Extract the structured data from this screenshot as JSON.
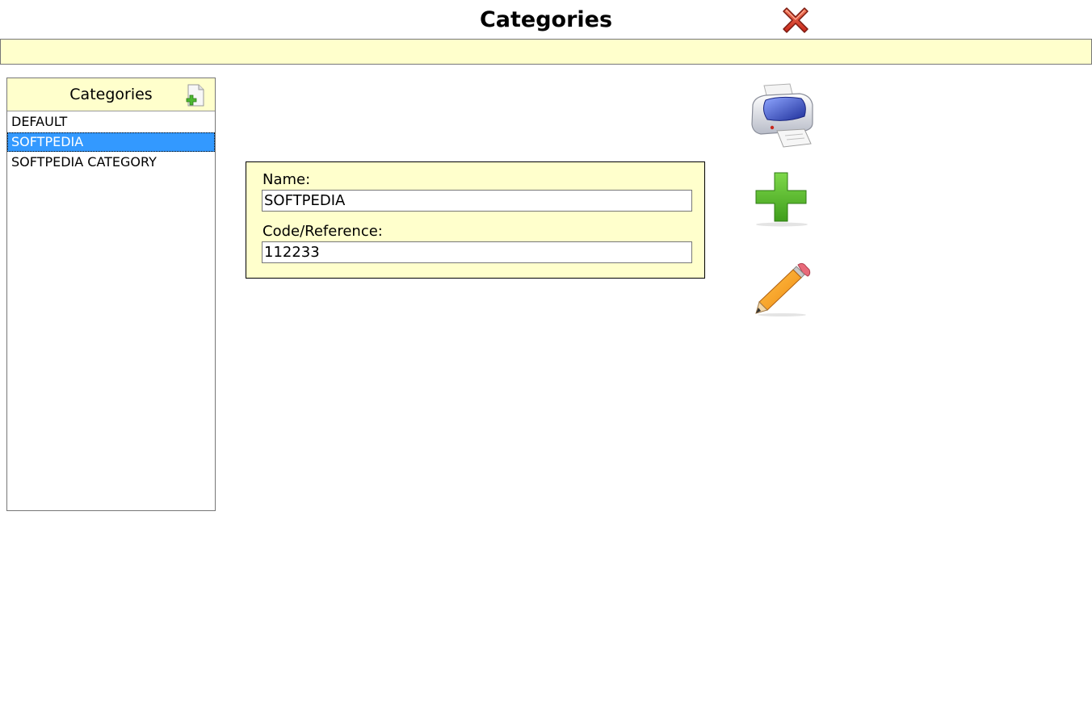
{
  "page": {
    "title": "Categories",
    "message": ""
  },
  "categories_panel": {
    "header": "Categories",
    "items": [
      {
        "label": "DEFAULT",
        "selected": false
      },
      {
        "label": "SOFTPEDIA",
        "selected": true
      },
      {
        "label": "SOFTPEDIA CATEGORY",
        "selected": false
      }
    ]
  },
  "form": {
    "name_label": "Name:",
    "name_value": "SOFTPEDIA",
    "code_label": "Code/Reference:",
    "code_value": "112233"
  },
  "icons": {
    "close": "close-icon",
    "add_category": "add-document-icon",
    "print": "printer-icon",
    "add": "plus-icon",
    "edit": "pencil-icon"
  },
  "colors": {
    "panel_bg": "#ffffcc",
    "selection": "#3399ff",
    "close_red": "#d9361a",
    "plus_green": "#5cb82c"
  }
}
